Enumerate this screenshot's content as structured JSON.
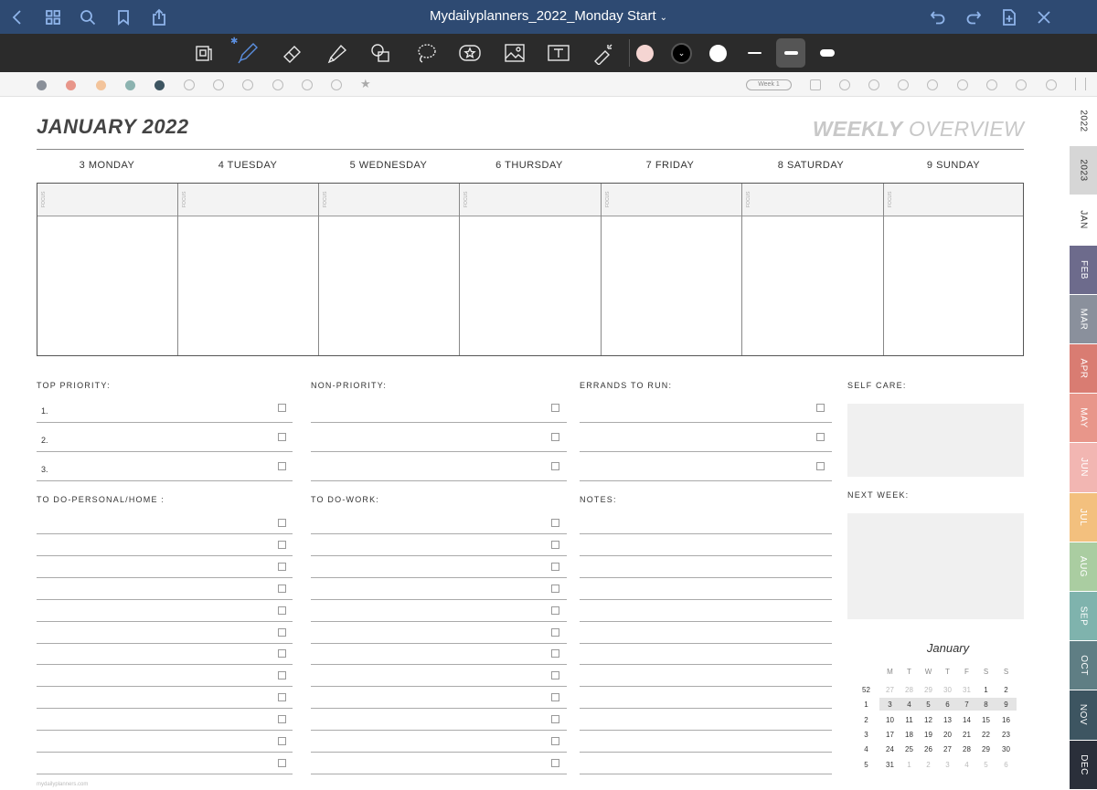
{
  "titlebar": {
    "document_title": "Mydailyplanners_2022_Monday Start",
    "chevron": "⌄"
  },
  "toolbar": {
    "tools": [
      "page-select-icon",
      "pen-icon",
      "eraser-icon",
      "highlighter-icon",
      "shapes-icon",
      "lasso-icon",
      "sticker-icon",
      "image-icon",
      "text-icon",
      "laser-pointer-icon"
    ],
    "bluetooth": "✱",
    "colors": [
      "#f5d5d2",
      "#000000",
      "#ffffff"
    ]
  },
  "quickbar": {
    "color_dots": [
      "#8a9099",
      "#e8968a",
      "#f3c49b",
      "#8cb3b0",
      "#3d5561"
    ],
    "week_label": "Week 1"
  },
  "page": {
    "month_title": "JANUARY 2022",
    "overview_bold": "WEEKLY",
    "overview_light": "OVERVIEW",
    "days": [
      "3 MONDAY",
      "4 TUESDAY",
      "5 WEDNESDAY",
      "6 THURSDAY",
      "7 FRIDAY",
      "8 SATURDAY",
      "9 SUNDAY"
    ],
    "focus_label": "FOCUS",
    "top_priority": "TOP PRIORITY:",
    "priority_numbers": [
      "1.",
      "2.",
      "3."
    ],
    "non_priority": "NON-PRIORITY:",
    "errands": "ERRANDS TO RUN:",
    "self_care": "SELF CARE:",
    "todo_personal": "TO DO-PERSONAL/HOME :",
    "todo_work": "TO DO-WORK:",
    "notes": "NOTES:",
    "next_week": "NEXT WEEK:",
    "footer": "mydailyplanners.com"
  },
  "mini_calendar": {
    "title": "January",
    "weekdays": [
      "M",
      "T",
      "W",
      "T",
      "F",
      "S",
      "S"
    ],
    "weeks": [
      {
        "wk": "52",
        "days": [
          "27",
          "28",
          "29",
          "30",
          "31",
          "1",
          "2"
        ],
        "dim": [
          true,
          true,
          true,
          true,
          true,
          false,
          false
        ]
      },
      {
        "wk": "1",
        "days": [
          "3",
          "4",
          "5",
          "6",
          "7",
          "8",
          "9"
        ],
        "dim": [
          false,
          false,
          false,
          false,
          false,
          false,
          false
        ]
      },
      {
        "wk": "2",
        "days": [
          "10",
          "11",
          "12",
          "13",
          "14",
          "15",
          "16"
        ],
        "dim": [
          false,
          false,
          false,
          false,
          false,
          false,
          false
        ]
      },
      {
        "wk": "3",
        "days": [
          "17",
          "18",
          "19",
          "20",
          "21",
          "22",
          "23"
        ],
        "dim": [
          false,
          false,
          false,
          false,
          false,
          false,
          false
        ]
      },
      {
        "wk": "4",
        "days": [
          "24",
          "25",
          "26",
          "27",
          "28",
          "29",
          "30"
        ],
        "dim": [
          false,
          false,
          false,
          false,
          false,
          false,
          false
        ]
      },
      {
        "wk": "5",
        "days": [
          "31",
          "1",
          "2",
          "3",
          "4",
          "5",
          "6"
        ],
        "dim": [
          false,
          true,
          true,
          true,
          true,
          true,
          true
        ]
      }
    ]
  },
  "tabs": [
    {
      "label": "2022",
      "color": "#ffffff",
      "light": true
    },
    {
      "label": "2023",
      "color": "#d6d6d6",
      "light": true
    },
    {
      "label": "JAN",
      "color": "#ffffff",
      "light": true
    },
    {
      "label": "FEB",
      "color": "#6d6b8c",
      "light": false
    },
    {
      "label": "MAR",
      "color": "#8a909c",
      "light": false
    },
    {
      "label": "APR",
      "color": "#d97c72",
      "light": false
    },
    {
      "label": "MAY",
      "color": "#e8968a",
      "light": false
    },
    {
      "label": "JUN",
      "color": "#f2b6b2",
      "light": false
    },
    {
      "label": "JUL",
      "color": "#f3c07e",
      "light": false
    },
    {
      "label": "AUG",
      "color": "#aacda1",
      "light": false
    },
    {
      "label": "SEP",
      "color": "#7fb3ad",
      "light": false
    },
    {
      "label": "OCT",
      "color": "#5f7e84",
      "light": false
    },
    {
      "label": "NOV",
      "color": "#3d5561",
      "light": false
    },
    {
      "label": "DEC",
      "color": "#2a2f3a",
      "light": false
    }
  ]
}
